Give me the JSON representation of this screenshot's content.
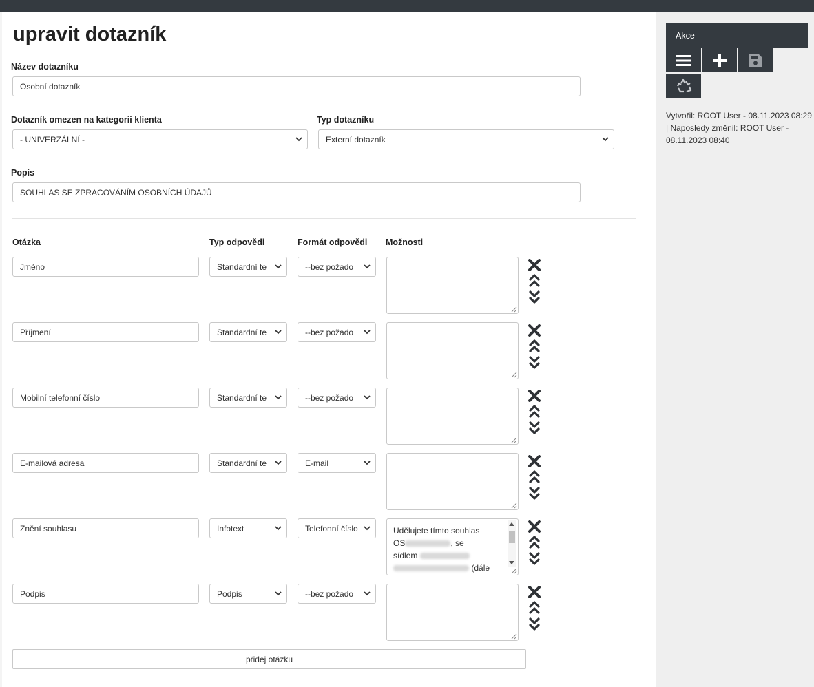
{
  "page": {
    "title": "upravit dotazník",
    "name_label": "Název dotazníku",
    "name_value": "Osobní dotazník",
    "category_label": "Dotazník omezen na kategorii klienta",
    "category_value": "- UNIVERZÁLNÍ -",
    "type_label": "Typ dotazníku",
    "type_value": "Externí dotazník",
    "desc_label": "Popis",
    "desc_value": "SOUHLAS SE ZPRACOVÁNÍM OSOBNÍCH ÚDAJŮ"
  },
  "questions": {
    "headers": {
      "question": "Otázka",
      "answer_type": "Typ odpovědi",
      "answer_format": "Formát odpovědi",
      "options": "Možnosti"
    },
    "rows": [
      {
        "question": "Jméno",
        "answer_type": "Standardní te",
        "answer_format": "--bez požado",
        "options": ""
      },
      {
        "question": "Příjmení",
        "answer_type": "Standardní te",
        "answer_format": "--bez požado",
        "options": ""
      },
      {
        "question": "Mobilní telefonní číslo",
        "answer_type": "Standardní te",
        "answer_format": "--bez požado",
        "options": ""
      },
      {
        "question": "E-mailová adresa",
        "answer_type": "Standardní te",
        "answer_format": "E-mail",
        "options": ""
      },
      {
        "question": "Znění souhlasu",
        "answer_type": "Infotext",
        "answer_format": "Telefonní číslo",
        "options_lines": [
          "Udělujete tímto souhlas",
          "OS",
          ", se",
          "sídlem",
          "(dále"
        ]
      },
      {
        "question": "Podpis",
        "answer_type": "Podpis",
        "answer_format": "--bez požado",
        "options": ""
      }
    ],
    "add_button": "přidej otázku"
  },
  "sidebar": {
    "actions_title": "Akce",
    "meta": "Vytvořil: ROOT User - 08.11.2023 08:29 | Naposledy změnil: ROOT User - 08.11.2023 08:40"
  },
  "icons": {
    "toolbar": [
      "menu-icon",
      "plus-icon",
      "save-icon",
      "recycle-icon"
    ],
    "row_controls": [
      "close-icon",
      "chevron-double-up-icon",
      "chevron-double-down-icon"
    ]
  },
  "colors": {
    "dark": "#343a40",
    "background": "#f4f4f4",
    "sidebar": "#efefef",
    "border": "#c9c9c9"
  }
}
